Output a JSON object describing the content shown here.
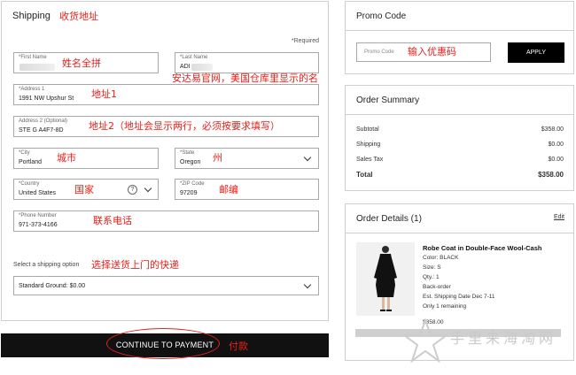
{
  "shipping": {
    "title": "Shipping",
    "title_note": "收货地址",
    "required": "*Required",
    "first_name": {
      "label": "*First Name",
      "note": "姓名全拼"
    },
    "last_name": {
      "label": "*Last Name",
      "value": "ADI"
    },
    "last_name_note": "安达易官网，美国仓库里显示的名",
    "address1": {
      "label": "*Address 1",
      "value": "1991 NW Upshur St",
      "note": "地址1"
    },
    "address2": {
      "label": "Address 2 (Optional)",
      "value": "STE G A4F7-8D",
      "note": "地址2（地址会显示两行，必须按要求填写）"
    },
    "city": {
      "label": "*City",
      "value": "Portland",
      "note": "城市"
    },
    "state": {
      "label": "*State",
      "value": "Oregon",
      "note": "州"
    },
    "country": {
      "label": "*Country",
      "value": "United States",
      "note": "国家",
      "help": "?"
    },
    "zip": {
      "label": "*ZIP Code",
      "value": "97209",
      "note": "邮编"
    },
    "phone": {
      "label": "*Phone Number",
      "value": "971-373-4166",
      "note": "联系电话"
    },
    "method_label": "Select a shipping option",
    "method_note": "选择送货上门的快递",
    "method_value": "Standard Ground: $0.00"
  },
  "cta": {
    "label": "CONTINUE TO PAYMENT",
    "note": "付款"
  },
  "promo": {
    "title": "Promo Code",
    "placeholder": "Promo Code",
    "note": "输入优惠码",
    "apply": "APPLY"
  },
  "summary": {
    "title": "Order Summary",
    "rows": [
      {
        "label": "Subtotal",
        "value": "$358.00"
      },
      {
        "label": "Shipping",
        "value": "$0.00"
      },
      {
        "label": "Sales Tax",
        "value": "$0.00"
      },
      {
        "label": "Total",
        "value": "$358.00"
      }
    ]
  },
  "details": {
    "title": "Order Details (1)",
    "edit": "Edit",
    "product": {
      "name": "Robe Coat in Double-Face Wool-Cash",
      "color": "Color: BLACK",
      "size": "Size: S",
      "qty": "Qty.: 1",
      "status": "Back-order",
      "ship_date": "Est. Shipping Date Dec 7-11",
      "remaining": "Only 1 remaining",
      "price": "$358.00"
    }
  },
  "watermark": "手里来海淘网",
  "colors": {
    "annotation": "#e8201a",
    "button": "#111111"
  }
}
